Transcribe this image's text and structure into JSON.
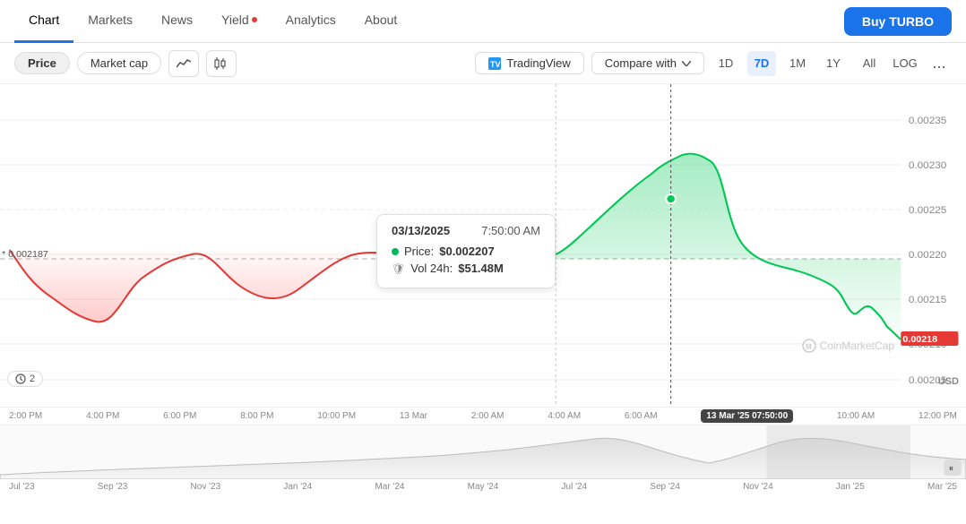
{
  "nav": {
    "tabs": [
      {
        "id": "chart",
        "label": "Chart",
        "active": true,
        "dot": false
      },
      {
        "id": "markets",
        "label": "Markets",
        "active": false,
        "dot": false
      },
      {
        "id": "news",
        "label": "News",
        "active": false,
        "dot": false
      },
      {
        "id": "yield",
        "label": "Yield",
        "active": false,
        "dot": true
      },
      {
        "id": "analytics",
        "label": "Analytics",
        "active": false,
        "dot": false
      },
      {
        "id": "about",
        "label": "About",
        "active": false,
        "dot": false
      }
    ],
    "buy_button": "Buy TURBO"
  },
  "toolbar": {
    "price_label": "Price",
    "market_cap_label": "Market cap",
    "tradingview_label": "TradingView",
    "compare_label": "Compare with",
    "ranges": [
      "1D",
      "7D",
      "1M",
      "1Y",
      "All"
    ],
    "active_range": "7D",
    "log_label": "LOG",
    "more_label": "..."
  },
  "tooltip": {
    "date": "03/13/2025",
    "time": "7:50:00 AM",
    "price_label": "Price:",
    "price_value": "$0.002207",
    "vol_label": "Vol 24h:",
    "vol_value": "$51.48M"
  },
  "chart": {
    "current_price": "0.00218",
    "reference_price": "* 0.002187",
    "price_levels": [
      "0.00235",
      "0.00230",
      "0.00225",
      "0.00220",
      "0.00215",
      "0.00210",
      "0.00205"
    ],
    "x_labels": [
      "2:00 PM",
      "4:00 PM",
      "6:00 PM",
      "8:00 PM",
      "10:00 PM",
      "13 Mar",
      "2:00 AM",
      "4:00 AM",
      "6:00 AM",
      "10:00 AM",
      "12:00 PM"
    ],
    "highlighted_time": "13 Mar '25 07:50:00",
    "usd_label": "USD",
    "watermark": "CoinMarketCap",
    "history_badge": "2",
    "mini_x_labels": [
      "Jul '23",
      "Sep '23",
      "Nov '23",
      "Jan '24",
      "Mar '24",
      "May '24",
      "Jul '24",
      "Sep '24",
      "Nov '24",
      "Jan '25",
      "Mar '25"
    ]
  }
}
